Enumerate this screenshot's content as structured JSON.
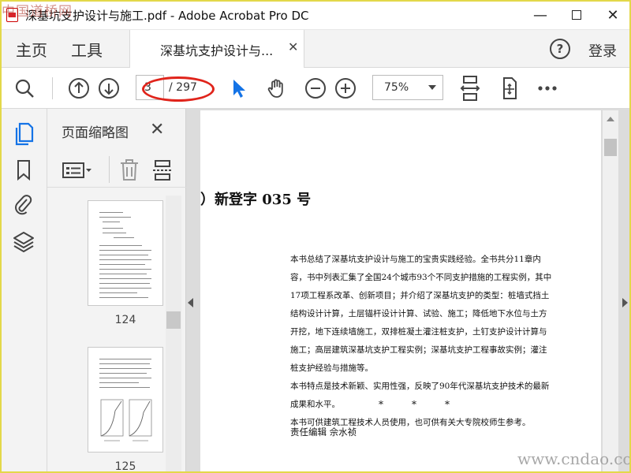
{
  "window": {
    "title": "深基坑支护设计与施工.pdf - Adobe Acrobat Pro DC",
    "corner_watermark": "中国道桥网",
    "minimize": "—",
    "close": "✕"
  },
  "menu": {
    "home": "主页",
    "tools": "工具",
    "tab_label": "深基坑支护设计与...",
    "tab_close": "✕",
    "help": "?",
    "login": "登录"
  },
  "toolbar": {
    "current_page": "3",
    "total_pages": "/ 297",
    "zoom": "75%"
  },
  "thumbnails_panel": {
    "title": "页面缩略图",
    "close": "✕",
    "pages": [
      {
        "label": "124"
      },
      {
        "label": "125"
      }
    ]
  },
  "document": {
    "heading": "）新登字 035 号",
    "paragraphs": [
      "本书总结了深基坑支护设计与施工的宝贵实践经验。全书共分11章内容，书中列表汇集了全国24个城市93个不同支护措施的工程实例，其中17项工程系改革、创新项目；并介绍了深基坑支护的类型：桩墙式挡土结构设计计算，土层锚杆设计计算、试验、施工；降低地下水位与土方开挖，地下连续墙施工，双排桩凝土灌注桩支护，土钉支护设计计算与施工；高层建筑深基坑支护工程实例；深基坑支护工程事故实例；灌注桩支护经验与措施等。",
      "本书特点是技术新颖、实用性强，反映了90年代深基坑支护技术的最新成果和水平。",
      "本书可供建筑工程技术人员使用，也可供有关大专院校师生参考。"
    ],
    "stars": [
      "*",
      "*",
      "*"
    ],
    "editor": "责任编辑   佘水祯"
  },
  "site_watermark": "www.cndao.com",
  "colors": {
    "accent_blue": "#1473e6",
    "annotation_red": "#e0241b",
    "chrome_gray": "#f3f3f3"
  }
}
